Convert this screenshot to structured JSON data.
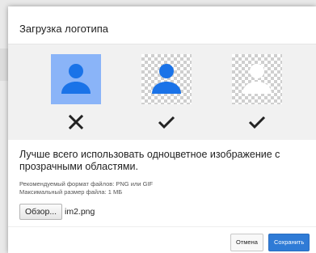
{
  "dialog": {
    "title": "Загрузка логотипа",
    "previews": [
      {
        "variant": "solid-blue-background",
        "status_icon": "cross-icon",
        "accent": "#8ab4f8",
        "figure_color": "#1a73e8"
      },
      {
        "variant": "transparent-blue-figure",
        "status_icon": "checkmark-icon",
        "figure_color": "#1a73e8"
      },
      {
        "variant": "transparent-white-figure",
        "status_icon": "checkmark-icon",
        "figure_color": "#ffffff"
      }
    ],
    "description": "Лучше всего использовать одноцветное изображение с прозрачными областями.",
    "format_note": "Рекомендуемый формат файлов: PNG или GIF",
    "size_note": "Максимальный размер файла: 1 МБ",
    "file_input": {
      "browse_label": "Обзор...",
      "file_name": "im2.png"
    },
    "actions": {
      "cancel_label": "Отмена",
      "save_label": "Сохранить"
    },
    "colors": {
      "primary": "#2f7bd6",
      "band": "#f1f1f1",
      "icon": "#222222"
    }
  }
}
